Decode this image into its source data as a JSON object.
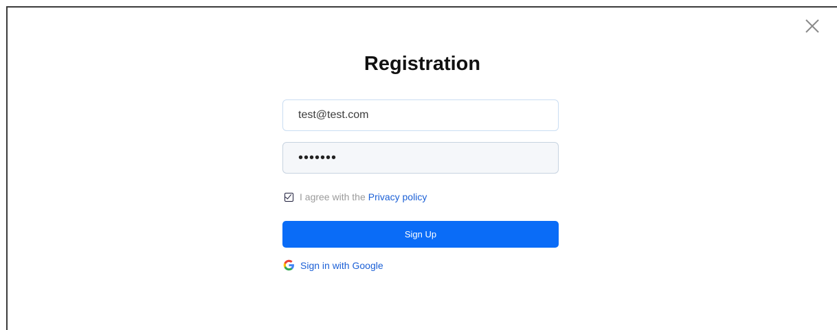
{
  "modal": {
    "title": "Registration",
    "close_icon": "close-icon"
  },
  "form": {
    "email_value": "test@test.com",
    "password_value": "•••••••",
    "agree_text": "I agree with the",
    "privacy_link": "Privacy policy",
    "signup_label": "Sign Up",
    "google_label": "Sign in with Google",
    "google_icon": "google-icon",
    "checkbox_checked": true
  },
  "colors": {
    "accent": "#0a6cf7",
    "link": "#1a5fd6",
    "muted_text": "#9a9a9a"
  }
}
